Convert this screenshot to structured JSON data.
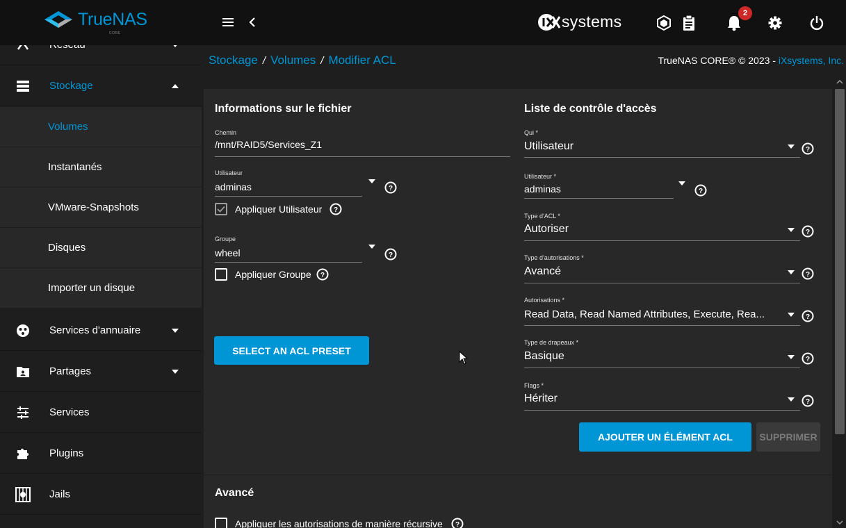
{
  "topbar": {
    "brand": "TrueNAS",
    "brand_sub": "CORE",
    "vendor": "systems",
    "notification_count": "2"
  },
  "sidebar": {
    "items": [
      {
        "label": "Réseau",
        "icon": "network-icon"
      },
      {
        "label": "Stockage",
        "icon": "storage-icon"
      },
      {
        "label": "Services d'annuaire",
        "icon": "directory-services-icon"
      },
      {
        "label": "Partages",
        "icon": "shares-folder-icon"
      },
      {
        "label": "Services",
        "icon": "services-tune-icon"
      },
      {
        "label": "Plugins",
        "icon": "plugins-puzzle-icon"
      },
      {
        "label": "Jails",
        "icon": "jails-icon"
      }
    ],
    "storage_sub": [
      "Volumes",
      "Instantanés",
      "VMware-Snapshots",
      "Disques",
      "Importer un disque"
    ]
  },
  "breadcrumb": {
    "items": [
      "Stockage",
      "Volumes",
      "Modifier ACL"
    ],
    "separator": "/"
  },
  "copyright": {
    "text": "TrueNAS CORE® © 2023 - ",
    "link": "iXsystems, Inc."
  },
  "file_info": {
    "title": "Informations sur le fichier",
    "path_label": "Chemin",
    "path_value": "/mnt/RAID5/Services_Z1",
    "user_label": "Utilisateur",
    "user_value": "adminas",
    "apply_user_label": "Appliquer Utilisateur",
    "apply_user_checked": true,
    "group_label": "Groupe",
    "group_value": "wheel",
    "apply_group_label": "Appliquer Groupe",
    "apply_group_checked": false,
    "preset_button": "SELECT AN ACL PRESET"
  },
  "acl": {
    "title": "Liste de contrôle d'accès",
    "who_label": "Qui *",
    "who_value": "Utilisateur",
    "user_label": "Utilisateur *",
    "user_value": "adminas",
    "acl_type_label": "Type d'ACL *",
    "acl_type_value": "Autoriser",
    "perm_type_label": "Type d'autorisations *",
    "perm_type_value": "Avancé",
    "perms_label": "Autorisations *",
    "perms_value": "Read Data, Read Named Attributes, Execute, Rea...",
    "flags_type_label": "Type de drapeaux *",
    "flags_type_value": "Basique",
    "flags_label": "Flags *",
    "flags_value": "Hériter",
    "add_button": "AJOUTER UN ÉLÉMENT ACL",
    "delete_button": "SUPPRIMER"
  },
  "advanced": {
    "title": "Avancé",
    "recursive_label": "Appliquer les autorisations de manière récursive"
  },
  "colors": {
    "accent": "#0095d5",
    "topbar_bg": "#111111",
    "panel_bg": "#282828",
    "page_bg": "#1e1e1e",
    "badge": "#ce2929"
  }
}
